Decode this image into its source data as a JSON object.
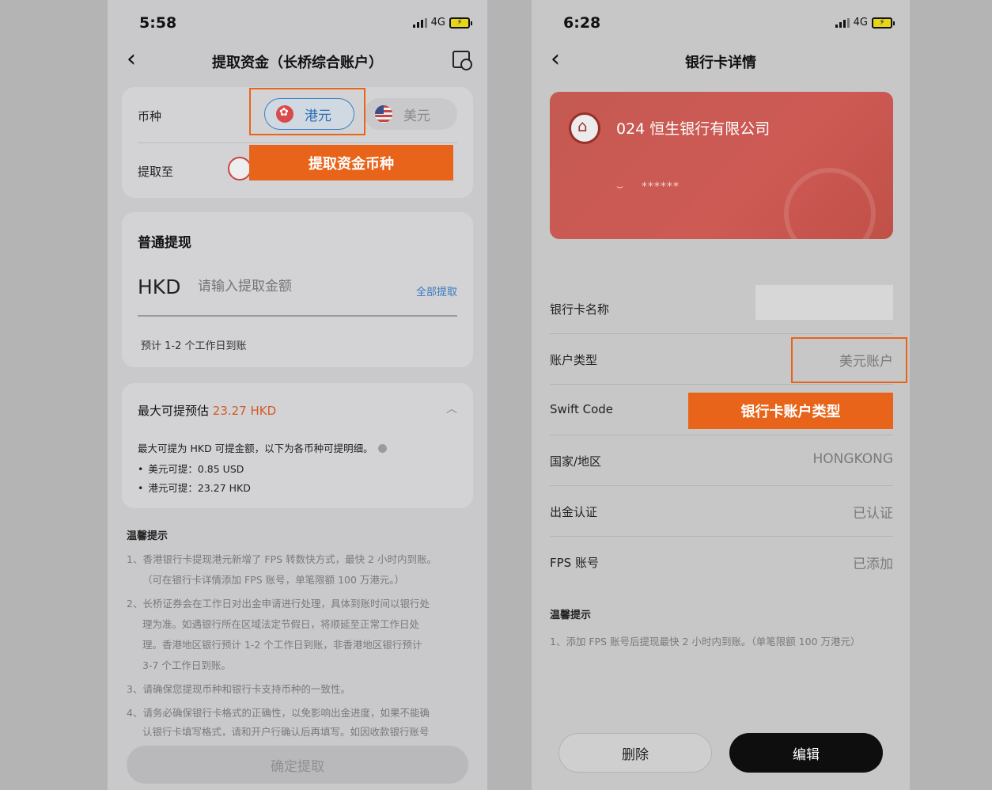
{
  "left": {
    "status": {
      "time": "5:58",
      "network": "4G"
    },
    "nav": {
      "title": "提取资金（长桥综合账户）"
    },
    "currency_card": {
      "currency_label": "币种",
      "hkd": "港元",
      "usd": "美元",
      "withdraw_to_label": "提取至",
      "annotation": "提取资金币种"
    },
    "normal": {
      "title": "普通提现",
      "currency": "HKD",
      "placeholder": "请输入提取金额",
      "withdraw_all": "全部提取",
      "arrival": "预计 1-2 个工作日到账"
    },
    "max": {
      "title_prefix": "最大可提预估 ",
      "title_value": "23.27 HKD",
      "desc": "最大可提为 HKD 可提金额，以下为各币种可提明细。",
      "usd_line": "美元可提：0.85 USD",
      "hkd_line": "港元可提：23.27 HKD"
    },
    "tips": {
      "title": "温馨提示",
      "t1a": "1、香港银行卡提现港元新增了 FPS 转数快方式，最快 2 小时内到账。",
      "t1b": "（可在银行卡详情添加 FPS 账号，单笔限额 100 万港元。）",
      "t2a": "2、长桥证券会在工作日对出金申请进行处理，具体到账时间以银行处",
      "t2b": "理为准。如遇银行所在区域法定节假日，将顺延至正常工作日处",
      "t2c": "理。香港地区银行预计 1-2 个工作日到账，非香港地区银行预计",
      "t2d": "3-7 个工作日到账。",
      "t3": "3、请确保您提现币种和银行卡支持币种的一致性。",
      "t4a": "4、请务必确保银行卡格式的正确性，以免影响出金进度，如果不能确",
      "t4b": "认银行卡填写格式，请和开户行确认后再填写。如因收款银行账号"
    },
    "confirm": "确定提取"
  },
  "right": {
    "status": {
      "time": "6:28",
      "network": "4G"
    },
    "nav": {
      "title": "银行卡详情"
    },
    "card": {
      "bank_name": "024 恒生银行有限公司",
      "masked": "******"
    },
    "rows": {
      "name_label": "银行卡名称",
      "type_label": "账户类型",
      "type_value": "美元账户",
      "swift_label": "Swift Code",
      "country_label": "国家/地区",
      "country_value": "HONGKONG",
      "cert_label": "出金认证",
      "cert_value": "已认证",
      "fps_label": "FPS 账号",
      "fps_value": "已添加"
    },
    "annotation": "银行卡账户类型",
    "tips": {
      "title": "温馨提示",
      "t1": "1、添加 FPS 账号后提现最快 2 小时内到账。（单笔限额 100 万港元）"
    },
    "delete": "删除",
    "edit": "编辑"
  },
  "colors": {
    "accent_orange": "#e8641a",
    "link_blue": "#3a78c0",
    "card_red": "#c95a52"
  }
}
